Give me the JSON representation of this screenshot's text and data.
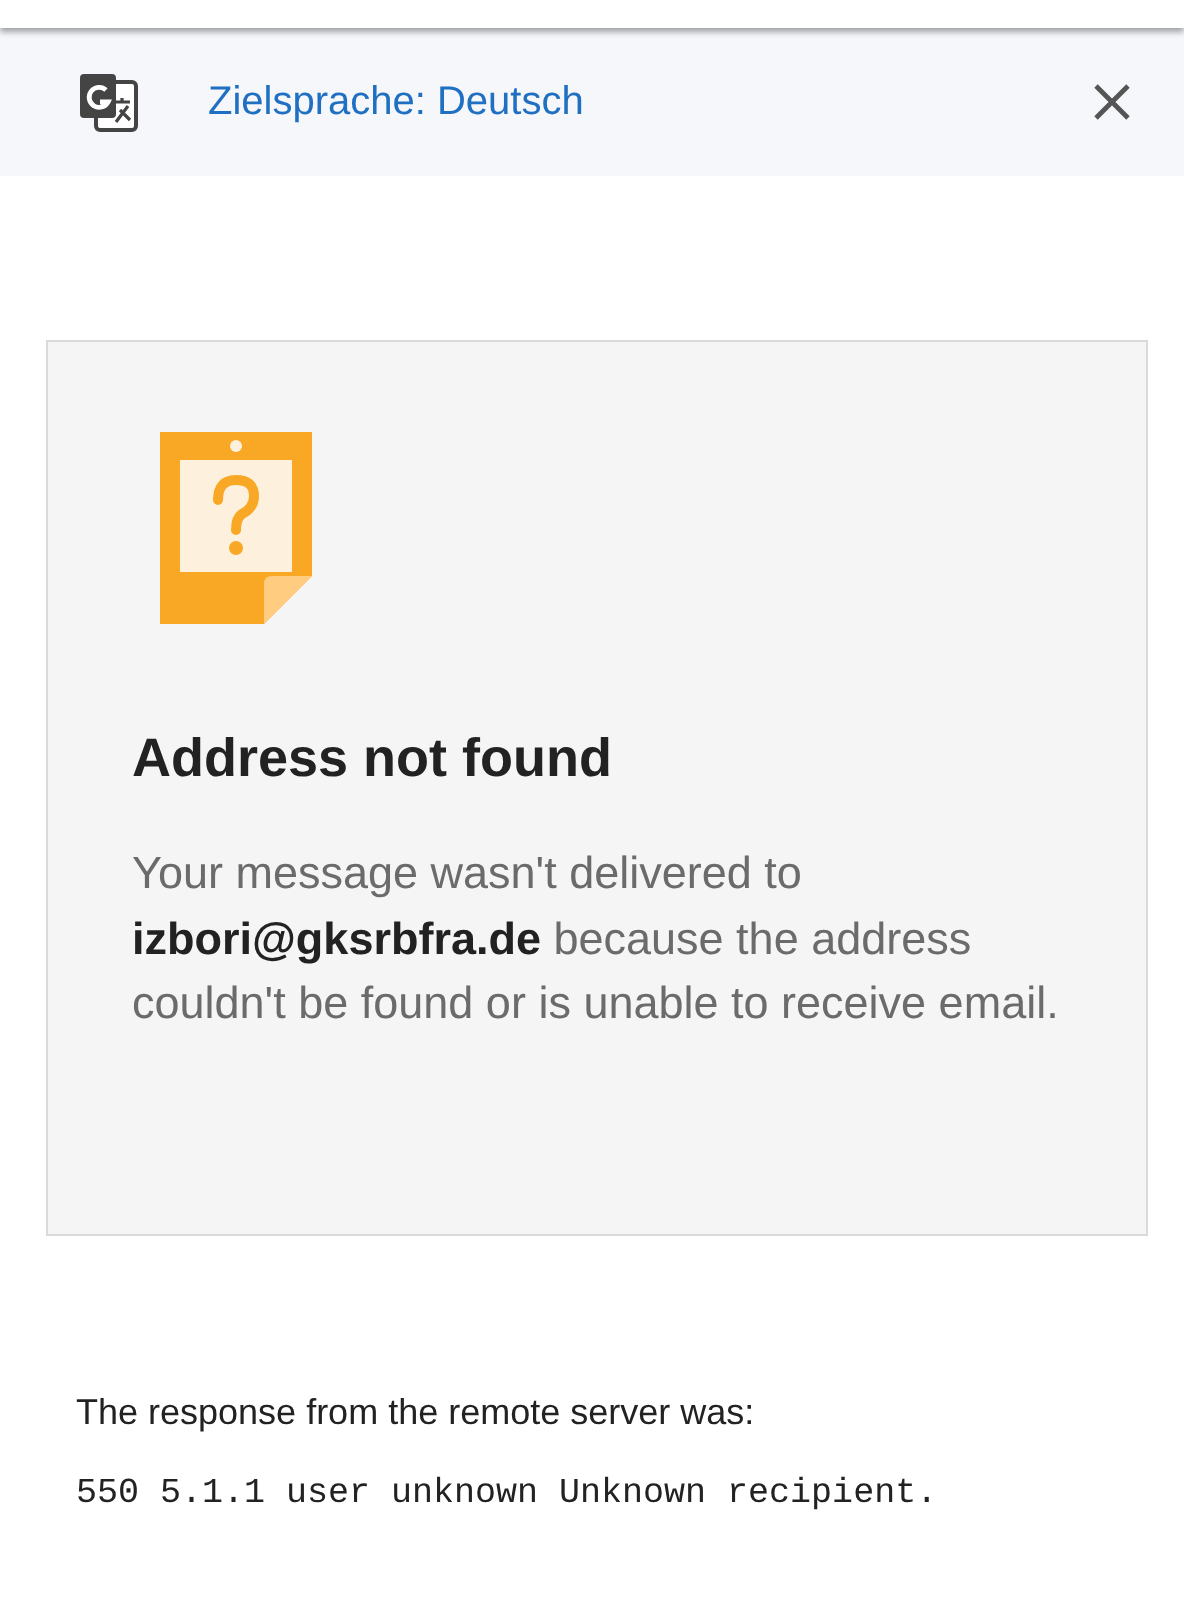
{
  "translate_bar": {
    "label": "Zielsprache: Deutsch"
  },
  "notice": {
    "title": "Address not found",
    "message": "Your message wasn't delivered to **izbori@gksrbfra.de** because the address couldn't be found or is unable to receive email."
  },
  "response": {
    "label": "The response from the remote server was:",
    "code": "550 5.1.1 user unknown Unknown recipient."
  }
}
